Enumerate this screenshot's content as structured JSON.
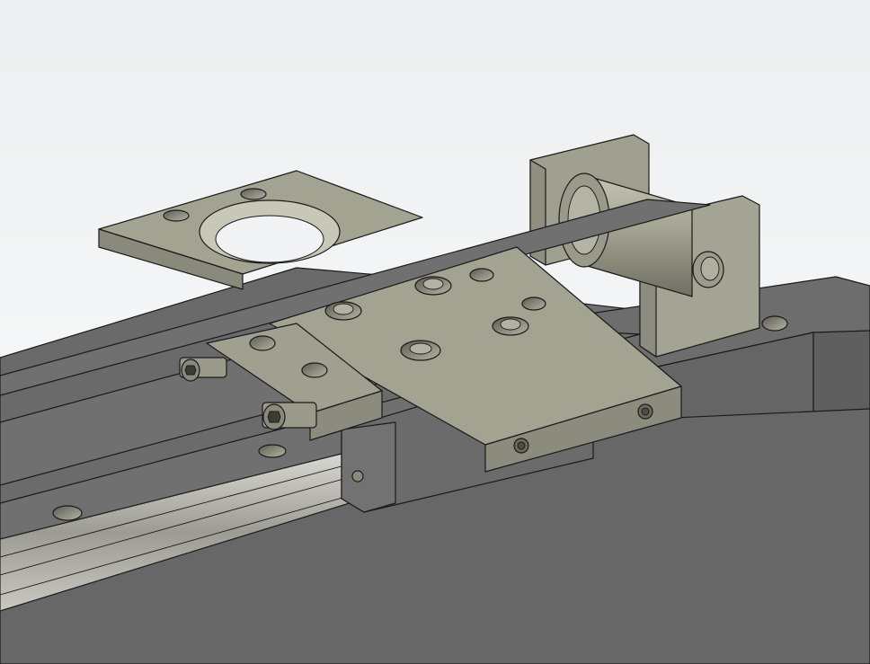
{
  "viewport": {
    "background": "gradient-light-grey",
    "model_color": "#6e6e6e",
    "part_color": "#a3a392",
    "edge_color": "#1a1a1a"
  },
  "model": {
    "parts": [
      "base-plate",
      "linear-guide-rail",
      "slider-carriage",
      "carriage-plate",
      "motor-mount-plate",
      "timing-belt",
      "belt-idler-pulley",
      "idler-bracket",
      "belt-clamp-bolts"
    ]
  }
}
